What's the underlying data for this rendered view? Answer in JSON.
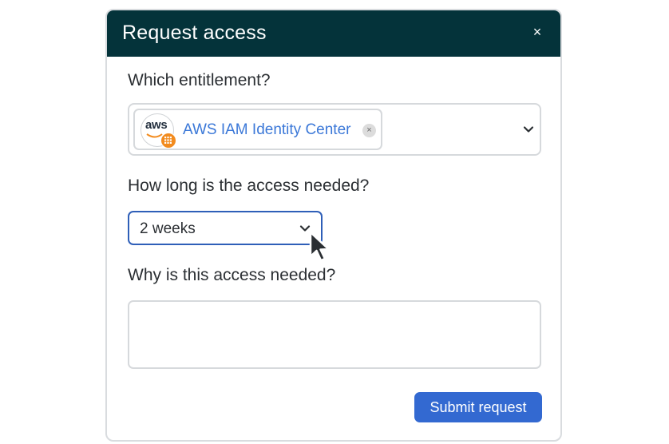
{
  "dialog": {
    "title": "Request access",
    "close_label": "×"
  },
  "entitlement": {
    "label": "Which entitlement?",
    "selected": {
      "name": "AWS IAM Identity Center",
      "logo_text": "aws",
      "logo_icon": "aws-logo-icon",
      "remove_label": "×"
    },
    "dropdown_icon": "chevron-down-icon"
  },
  "duration": {
    "label": "How long is the access needed?",
    "value": "2 weeks",
    "dropdown_icon": "chevron-down-icon"
  },
  "reason": {
    "label": "Why is this access needed?",
    "value": ""
  },
  "submit": {
    "label": "Submit request"
  },
  "colors": {
    "header_bg": "#04333a",
    "accent": "#3369d1",
    "chip_text": "#3b78d8",
    "focus_border": "#2f5fb8",
    "aws_orange": "#f28b1e"
  }
}
